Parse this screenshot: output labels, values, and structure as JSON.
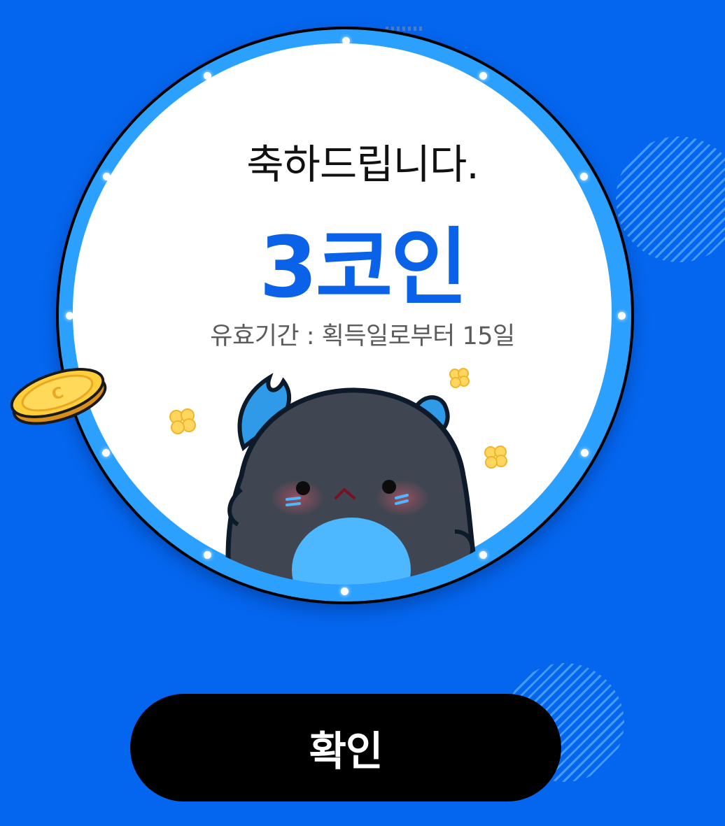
{
  "popup": {
    "congrats_text": "축하드립니다.",
    "reward_text": "3코인",
    "validity_text": "유효기간 : 획득일로부터 15일"
  },
  "actions": {
    "confirm_label": "확인"
  },
  "colors": {
    "background": "#0466ee",
    "ring": "#2ba0ff",
    "reward_text": "#0a62e8",
    "button": "#000000",
    "button_text": "#ffffff"
  },
  "icons": {
    "coin": "coin-icon",
    "mascot": "mascot-character",
    "sparkle": "popcorn-sparkle-icon"
  }
}
